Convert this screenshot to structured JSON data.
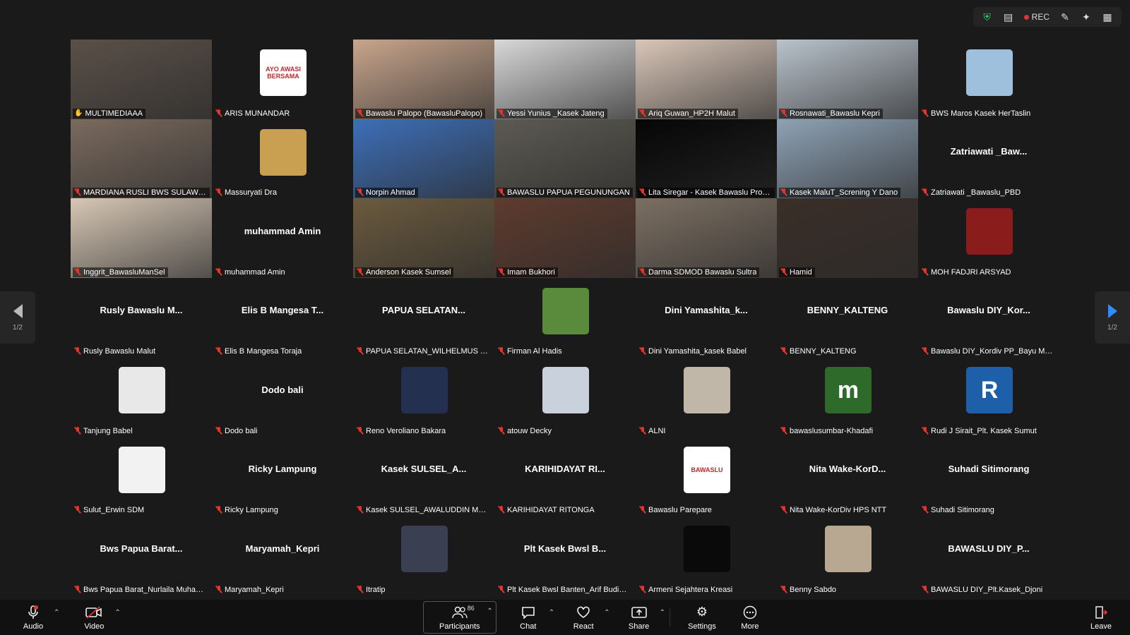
{
  "tray": {
    "rec_label": "REC"
  },
  "pagination": {
    "left": "1/2",
    "right": "1/2"
  },
  "tiles": [
    {
      "name": "MULTIMEDIAAA",
      "kind": "video",
      "bg": "#5a5048",
      "active": true,
      "muted": false
    },
    {
      "name": "ARIS MUNANDAR",
      "kind": "avatar",
      "avatar_bg": "#ffffff",
      "avatar_text": "AYO AWASI BERSAMA",
      "muted": true
    },
    {
      "name": "Bawaslu Palopo (BawasluPalopo)",
      "kind": "video",
      "bg": "#c8a58c",
      "muted": true
    },
    {
      "name": "Yessi Yunius _Kasek Jateng",
      "kind": "video",
      "bg": "#d8d8d8",
      "muted": true
    },
    {
      "name": "Ariq Guwan_HP2H Malut",
      "kind": "video",
      "bg": "#d9c6b8",
      "muted": true
    },
    {
      "name": "Rosnawati_Bawaslu Kepri",
      "kind": "video",
      "bg": "#b9c3cc",
      "muted": true
    },
    {
      "name": "BWS Maros Kasek HerTaslin",
      "kind": "avatar",
      "avatar_bg": "#9ec0dc",
      "avatar_text": "",
      "muted": true
    },
    {
      "name": "MARDIANA RUSLI BWS SULAWESI ...",
      "kind": "video",
      "bg": "#7a6a5e",
      "muted": true
    },
    {
      "name": "Massuryati Dra",
      "kind": "avatar",
      "avatar_bg": "#c9a052",
      "avatar_text": "",
      "muted": true
    },
    {
      "name": "Norpin Ahmad",
      "kind": "video",
      "bg": "#3d6fb8",
      "muted": true
    },
    {
      "name": "BAWASLU PAPUA PEGUNUNGAN",
      "kind": "video",
      "bg": "#5c5a52",
      "muted": true
    },
    {
      "name": "Lita Siregar - Kasek Bawaslu Provi...",
      "kind": "video",
      "bg": "#060606",
      "muted": true
    },
    {
      "name": "Kasek MaluT_Screning Y Dano",
      "kind": "video",
      "bg": "#8ea2b5",
      "muted": true
    },
    {
      "name": "Zatriawati _Bawaslu_PBD",
      "kind": "text",
      "display": "Zatriawati _Baw...",
      "muted": true
    },
    {
      "name": "Inggrit_BawasluManSel",
      "kind": "video",
      "bg": "#d7c7b5",
      "muted": true
    },
    {
      "name": "muhammad Amin",
      "kind": "text",
      "display": "muhammad Amin",
      "muted": true
    },
    {
      "name": "Anderson Kasek Sumsel",
      "kind": "video",
      "bg": "#6b5a3e",
      "muted": true
    },
    {
      "name": "Imam Bukhori",
      "kind": "video",
      "bg": "#5e3b2e",
      "muted": true
    },
    {
      "name": "Darma SDMOD Bawaslu Sultra",
      "kind": "video",
      "bg": "#7c6f62",
      "muted": true
    },
    {
      "name": "Hamid",
      "kind": "video",
      "bg": "#3a2e28",
      "muted": true
    },
    {
      "name": "MOH FADJRI ARSYAD",
      "kind": "avatar",
      "avatar_bg": "#8a1c1c",
      "avatar_text": "",
      "muted": true
    },
    {
      "name": "Rusly Bawaslu Malut",
      "kind": "text",
      "display": "Rusly Bawaslu M...",
      "muted": true
    },
    {
      "name": "Elis B Mangesa Toraja",
      "kind": "text",
      "display": "Elis B Mangesa T...",
      "muted": true
    },
    {
      "name": "PAPUA SELATAN_WILHELMUS YODI...",
      "kind": "text",
      "display": "PAPUA SELATAN...",
      "muted": true
    },
    {
      "name": "Firman Al Hadis",
      "kind": "avatar",
      "avatar_bg": "#5a8b3c",
      "avatar_text": "",
      "muted": true
    },
    {
      "name": "Dini Yamashita_kasek Babel",
      "kind": "text",
      "display": "Dini Yamashita_k...",
      "muted": true
    },
    {
      "name": "BENNY_KALTENG",
      "kind": "text",
      "display": "BENNY_KALTENG",
      "muted": true
    },
    {
      "name": "Bawaslu DIY_Kordiv PP_Bayu Mardi...",
      "kind": "text",
      "display": "Bawaslu DIY_Kor...",
      "muted": true
    },
    {
      "name": "Tanjung Babel",
      "kind": "avatar",
      "avatar_bg": "#e8e8e8",
      "avatar_text": "",
      "muted": true
    },
    {
      "name": "Dodo bali",
      "kind": "text",
      "display": "Dodo bali",
      "muted": true
    },
    {
      "name": "Reno Veroliano Bakara",
      "kind": "avatar",
      "avatar_bg": "#23304f",
      "avatar_text": "",
      "muted": true
    },
    {
      "name": "atouw Decky",
      "kind": "avatar",
      "avatar_bg": "#c9d2dc",
      "avatar_text": "",
      "muted": true
    },
    {
      "name": "ALNI",
      "kind": "avatar",
      "avatar_bg": "#c0b7a8",
      "avatar_text": "",
      "muted": true
    },
    {
      "name": "bawaslusumbar-Khadafi",
      "kind": "avatar",
      "avatar_bg": "#2e6b2a",
      "avatar_text": "m",
      "muted": true
    },
    {
      "name": "Rudi J Sirait_Plt. Kasek Sumut",
      "kind": "avatar",
      "avatar_bg": "#1d5fa8",
      "avatar_text": "R",
      "muted": true
    },
    {
      "name": "Sulut_Erwin SDM",
      "kind": "avatar",
      "avatar_bg": "#f2f2f2",
      "avatar_text": "",
      "muted": true
    },
    {
      "name": "Ricky Lampung",
      "kind": "text",
      "display": "Ricky Lampung",
      "muted": true
    },
    {
      "name": "Kasek SULSEL_AWALUDDIN MUST...",
      "kind": "text",
      "display": "Kasek SULSEL_A...",
      "muted": true
    },
    {
      "name": "KARIHIDAYAT RITONGA",
      "kind": "text",
      "display": "KARIHIDAYAT RI...",
      "muted": true
    },
    {
      "name": "Bawaslu Parepare",
      "kind": "avatar",
      "avatar_bg": "#ffffff",
      "avatar_text": "BAWASLU",
      "muted": true
    },
    {
      "name": "Nita Wake-KorDiv HPS NTT",
      "kind": "text",
      "display": "Nita Wake-KorD...",
      "muted": true
    },
    {
      "name": "Suhadi Sitimorang",
      "kind": "text",
      "display": "Suhadi Sitimorang",
      "muted": true
    },
    {
      "name": "Bws Papua Barat_Nurlaila Muham...",
      "kind": "text",
      "display": "Bws Papua Barat...",
      "muted": true
    },
    {
      "name": "Maryamah_Kepri",
      "kind": "text",
      "display": "Maryamah_Kepri",
      "muted": true
    },
    {
      "name": "Itratip",
      "kind": "avatar",
      "avatar_bg": "#3a3f52",
      "avatar_text": "",
      "muted": true
    },
    {
      "name": "Plt Kasek Bwsl Banten_Arif Budiman",
      "kind": "text",
      "display": "Plt Kasek Bwsl B...",
      "muted": true
    },
    {
      "name": "Armeni Sejahtera Kreasi",
      "kind": "avatar",
      "avatar_bg": "#0a0a0a",
      "avatar_text": "",
      "muted": true
    },
    {
      "name": "Benny Sabdo",
      "kind": "avatar",
      "avatar_bg": "#b8a892",
      "avatar_text": "",
      "muted": true
    },
    {
      "name": "BAWASLU DIY_Plt.Kasek_Djoni",
      "kind": "text",
      "display": "BAWASLU DIY_P...",
      "muted": true
    }
  ],
  "toolbar": {
    "audio": "Audio",
    "video": "Video",
    "participants": "Participants",
    "participants_count": "86",
    "chat": "Chat",
    "react": "React",
    "share": "Share",
    "settings": "Settings",
    "more": "More",
    "leave": "Leave"
  }
}
